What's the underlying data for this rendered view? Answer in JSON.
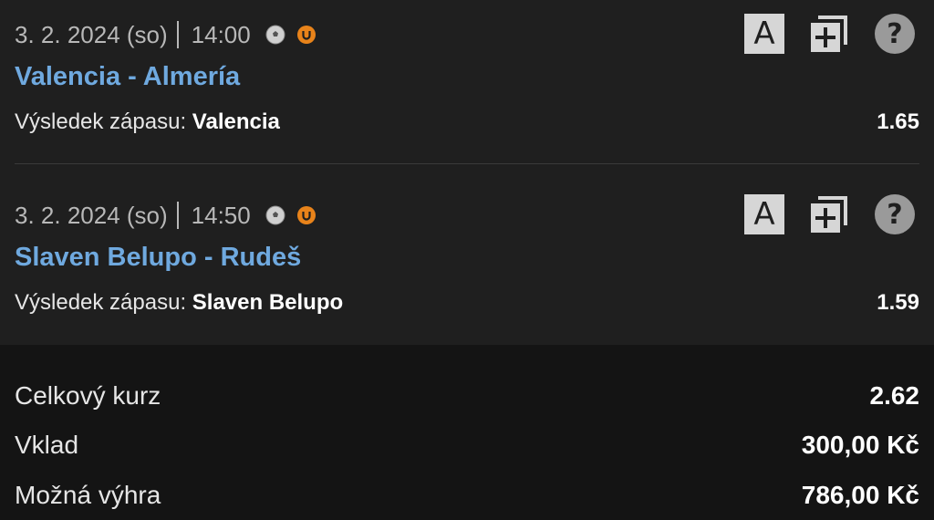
{
  "bets": [
    {
      "date": "3. 2. 2024 (so)",
      "time": "14:00",
      "match": "Valencia - Almería",
      "market_label": "Výsledek zápasu:",
      "pick": "Valencia",
      "odd": "1.65"
    },
    {
      "date": "3. 2. 2024 (so)",
      "time": "14:50",
      "match": "Slaven Belupo - Rudeš",
      "market_label": "Výsledek zápasu:",
      "pick": "Slaven Belupo",
      "odd": "1.59"
    }
  ],
  "tools": {
    "a_label": "A",
    "icons": [
      "letter-a-icon",
      "add-copy-icon",
      "help-icon"
    ]
  },
  "summary": {
    "total_odds_label": "Celkový kurz",
    "total_odds": "2.62",
    "stake_label": "Vklad",
    "stake": "300,00 Kč",
    "win_label": "Možná výhra",
    "win": "786,00 Kč"
  },
  "colors": {
    "background": "#1f1f1f",
    "summary_background": "#141414",
    "match_link": "#6fa9df",
    "live_badge": "#e8831a",
    "icon_gray": "#d6d6d6"
  }
}
